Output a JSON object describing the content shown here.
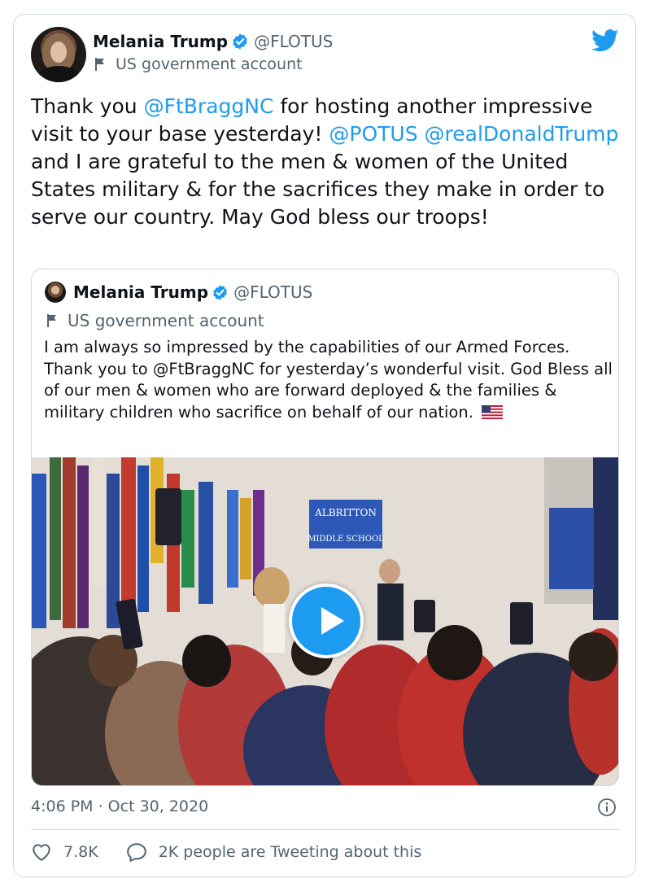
{
  "tweet": {
    "author": {
      "name": "Melania Trump",
      "handle": "@FLOTUS",
      "label": "US government account"
    },
    "text_parts": [
      "Thank you ",
      "@FtBraggNC",
      " for hosting another impressive visit to your base yesterday! ",
      "@POTUS",
      " ",
      "@realDonaldTrump",
      " and I are grateful to the men & women of the United States military & for the sacrifices they make in order to serve our country. May God bless our troops!"
    ],
    "timestamp": "4:06 PM · Oct 30, 2020",
    "likes": "7.8K",
    "replies_text": "2K people are Tweeting about this"
  },
  "quoted": {
    "author": {
      "name": "Melania Trump",
      "handle": "@FLOTUS",
      "label": "US government account"
    },
    "text": "I am always so impressed by the capabilities of our Armed Forces. Thank you to @FtBraggNC for yesterday’s wonderful visit. God Bless all of our men & women who are forward deployed & the families & military children who sacrifice on behalf of our nation.",
    "media": {
      "type": "video",
      "sign_lines": [
        "ALBRITTON",
        "MIDDLE SCHOOL"
      ]
    }
  },
  "icons": {
    "verified": "verified-badge-icon",
    "flag": "government-flag-icon",
    "brand": "twitter-bird-icon",
    "play": "play-icon",
    "info": "info-icon",
    "like": "heart-icon",
    "reply": "speech-bubble-icon",
    "emoji": "us-flag-emoji"
  },
  "colors": {
    "accent": "#1d9bf0",
    "text": "#0f1419",
    "secondary": "#536471",
    "border": "#cfd9de"
  }
}
